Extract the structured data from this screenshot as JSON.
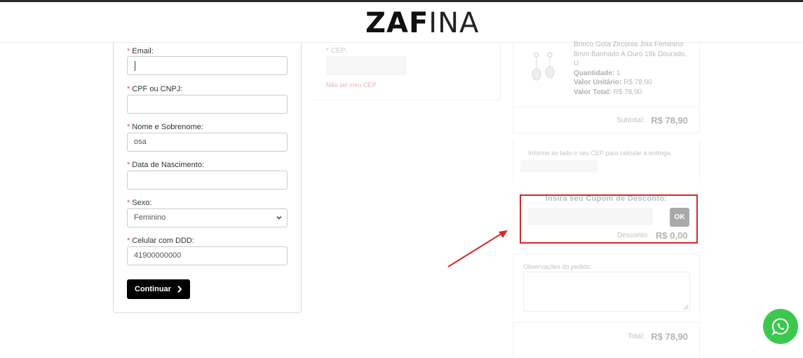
{
  "brand": {
    "logo_bold": "ZAF",
    "logo_thin": "INA"
  },
  "form": {
    "email_label": "Email:",
    "email_value": "",
    "cpf_label": "CPF ou CNPJ:",
    "cpf_value": "",
    "name_label": "Nome e Sobrenome:",
    "name_value": "osa",
    "birth_label": "Data de Nascimento:",
    "birth_value": "",
    "sex_label": "Sexo:",
    "sex_value": "Feminino",
    "phone_label": "Celular com DDD:",
    "phone_value": "41900000000",
    "required_mark": "*",
    "continue_label": "Continuar"
  },
  "shipping_form": {
    "cep_label": "CEP:",
    "not_my_cep": "Não sei meu CEP"
  },
  "summary": {
    "product_name": "Brinco Gota Zirconia Joia Feminino 8mm Banhado A Ouro 18k Dourado, U",
    "qty_label": "Quantidade:",
    "qty_value": "1",
    "unit_label": "Valor Unitário:",
    "unit_value": "R$ 78,90",
    "total_item_label": "Valor Total:",
    "total_item_value": "R$ 78,90",
    "subtotal_label": "Subtotal:",
    "subtotal_value": "R$ 78,90",
    "shipping_info": "Informe ao lado o seu CEP para calcular a entrega.",
    "coupon_title": "Insira seu Cupom de Desconto:",
    "ok_label": "OK",
    "discount_label": "Desconto:",
    "discount_value": "R$ 0,00",
    "notes_label": "Observações do pedido:",
    "total_label": "Total:",
    "total_value": "R$ 78,90"
  },
  "colors": {
    "annotation_red": "#d42a2a",
    "whatsapp_green": "#3cc84f",
    "button_black": "#000000"
  },
  "icons": [
    "chevron-down-icon",
    "chevron-right-icon",
    "earring-product-image",
    "whatsapp-icon",
    "annotation-arrow"
  ]
}
